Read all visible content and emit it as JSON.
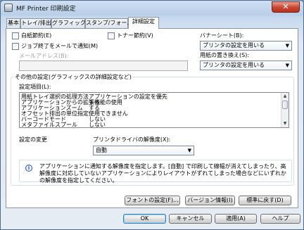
{
  "window": {
    "title": "MF Printer 印刷設定",
    "close_glyph": "✕"
  },
  "tabs": [
    {
      "label": "基本"
    },
    {
      "label": "トレイ/排出"
    },
    {
      "label": "グラフィックス"
    },
    {
      "label": "スタンプ/フォーム"
    },
    {
      "label": "詳細設定"
    }
  ],
  "options": {
    "bw_save": "白紙節約(E)",
    "toner_save": "トナー節約(V)",
    "job_mail": "ジョブ終了をメールで通知(M)",
    "mail_address_label": "メールアドレス(B):",
    "mail_address_value": ""
  },
  "banner": {
    "label": "バナーシート(B):",
    "value": "プリンタの設定を用いる"
  },
  "paper_replace": {
    "label": "用紙の置き換え(S):",
    "value": "プリンタの設定を用いる"
  },
  "other_group": {
    "title": "その他の設定(グラフィックスの詳細設定など)"
  },
  "settings_list": {
    "label": "設定項目(L):",
    "rows": [
      {
        "name": "用紙トレイ選択の処理方法",
        "value": "アプリケーションの設定を優先"
      },
      {
        "name": "アプリケーションからの拡張機能の使用",
        "value": "する"
      },
      {
        "name": "アプリケーションズーム",
        "value": "する"
      },
      {
        "name": "オフセット排出の単位指定",
        "value": "使用できません"
      },
      {
        "name": "バーコードモード",
        "value": "しない"
      },
      {
        "name": "メタファイルスプール",
        "value": "しない"
      }
    ]
  },
  "change": {
    "label": "設定の変更",
    "resolution_label": "プリンタドライバの解像度(X):",
    "resolution_value": "自動"
  },
  "info": {
    "icon": "i",
    "text": "アプリケーションに通知する解像度を指定します。[自動] で印刷して線幅が消えてしまったり、高解像度に対応していないアプリケーションによりレイアウトがずれてしまった場合などにいずれかの解像度を指定してください。"
  },
  "panel_buttons": {
    "font_settings": "フォントの設定(F)...",
    "version_info": "バージョン情報(I)",
    "restore_default": "標準に戻す(D)"
  },
  "footer_buttons": {
    "ok": "OK",
    "cancel": "キャンセル",
    "apply": "適用(A)",
    "help": "ヘルプ"
  }
}
